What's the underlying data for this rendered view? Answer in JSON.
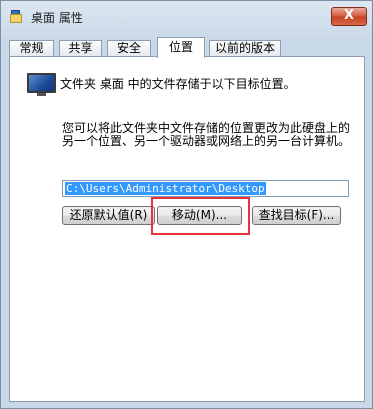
{
  "window": {
    "title": "桌面 属性",
    "close_label": "X"
  },
  "tabs": [
    {
      "label": "常规"
    },
    {
      "label": "共享"
    },
    {
      "label": "安全"
    },
    {
      "label": "位置"
    },
    {
      "label": "以前的版本"
    }
  ],
  "active_tab": "位置",
  "location": {
    "stored_text": "文件夹 桌面 中的文件存储于以下目标位置。",
    "description": "您可以将此文件夹中文件存储的位置更改为此硬盘上的另一个位置、另一个驱动器或网络上的另一台计算机。",
    "path_value": "C:\\Users\\Administrator\\Desktop"
  },
  "buttons": {
    "restore_default": "还原默认值(R)",
    "move": "移动(M)...",
    "find_target": "查找目标(F)..."
  },
  "colors": {
    "highlight": "#e8333a",
    "selection": "#3399ff"
  }
}
